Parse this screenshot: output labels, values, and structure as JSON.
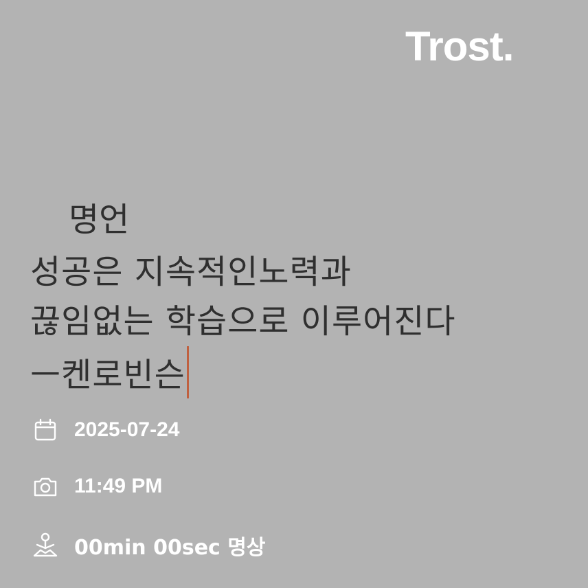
{
  "app": {
    "brand": "Trost."
  },
  "note": {
    "title": "명언",
    "lines": [
      "성공은  지속적인노력과",
      "끊임없는  학습으로  이루어진다",
      "ㅡ켄로빈슨"
    ],
    "cursor_color": "#c0603f"
  },
  "meta": {
    "date": "2025-07-24",
    "time": "11:49 PM",
    "meditation": "00min 00sec 명상",
    "icons": [
      "calendar-icon",
      "camera-icon",
      "meditation-icon"
    ]
  },
  "colors": {
    "background": "#b3b3b3",
    "text": "#2f2f2f",
    "meta_text": "#ffffff"
  }
}
